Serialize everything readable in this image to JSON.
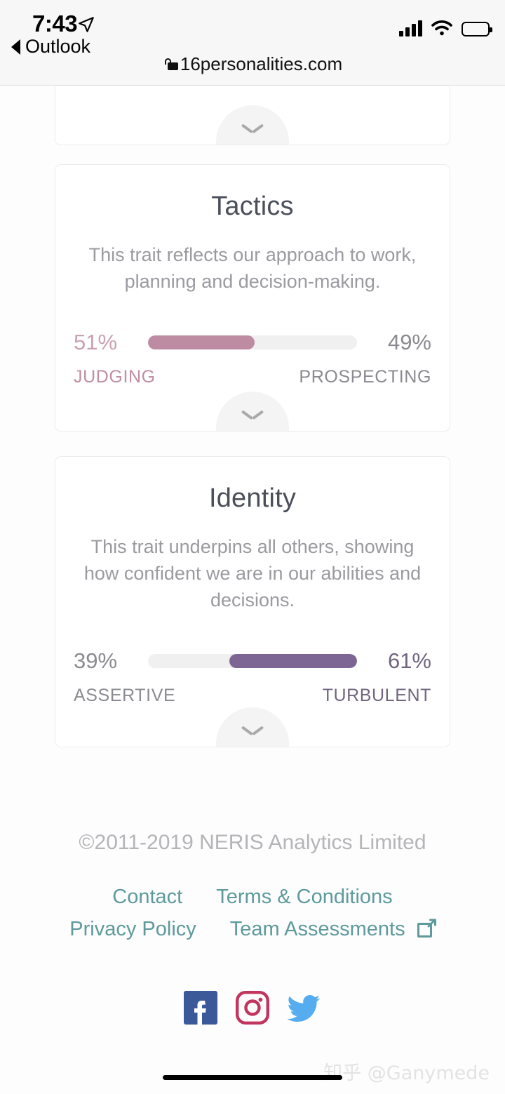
{
  "status_bar": {
    "time": "7:43",
    "location_icon": "location-arrow-icon",
    "back_label": "Outlook",
    "signal_icon": "cellular-signal-icon",
    "wifi_icon": "wifi-icon",
    "battery_icon": "battery-icon",
    "lock_icon": "lock-icon",
    "url": "16personalities.com"
  },
  "colors": {
    "page_bg": "#fdfdfd",
    "card_bg": "#ffffff",
    "card_border": "#ededed",
    "title": "#4a4f5a",
    "description": "#9a9aa0",
    "track": "#f0f0f0",
    "tactics_accent": "#bd8ba2",
    "tactics_label": "#c08ea4",
    "identity_accent": "#7d6694",
    "identity_label": "#72657f",
    "neutral_label": "#8a8a92",
    "footer_link": "#5e9a9c",
    "copyright": "#b5b5b9",
    "facebook": "#3b5998",
    "instagram": "#c1355e",
    "twitter": "#55acee"
  },
  "cards": {
    "partial_top": {
      "expand_icon": "chevron-down-icon"
    },
    "tactics": {
      "title": "Tactics",
      "description": "This trait reflects our approach to work, planning and decision-making.",
      "left_percent": "51%",
      "right_percent": "49%",
      "left_label": "JUDGING",
      "right_label": "PROSPECTING",
      "fill_side": "left",
      "fill_value": 51,
      "expand_icon": "chevron-down-icon"
    },
    "identity": {
      "title": "Identity",
      "description": "This trait underpins all others, showing how confident we are in our abilities and decisions.",
      "left_percent": "39%",
      "right_percent": "61%",
      "left_label": "ASSERTIVE",
      "right_label": "TURBULENT",
      "fill_side": "right",
      "fill_value": 61,
      "expand_icon": "chevron-down-icon"
    }
  },
  "footer": {
    "copyright": "©2011-2019 NERIS Analytics Limited",
    "links_row1": [
      {
        "label": "Contact"
      },
      {
        "label": "Terms & Conditions"
      }
    ],
    "links_row2": [
      {
        "label": "Privacy Policy"
      },
      {
        "label": "Team Assessments",
        "external_icon": "external-link-icon"
      }
    ],
    "socials": [
      {
        "name": "facebook-icon"
      },
      {
        "name": "instagram-icon"
      },
      {
        "name": "twitter-icon"
      }
    ]
  },
  "watermark": "知乎 @Ganymede"
}
